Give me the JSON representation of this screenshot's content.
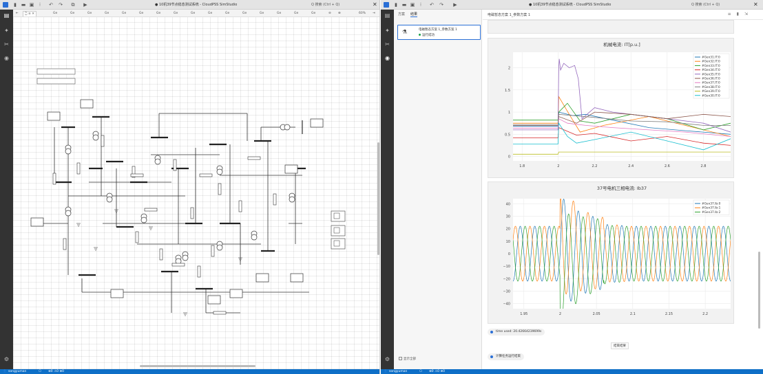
{
  "left": {
    "title": "● 10机39节点稳态测试系统 - CloudPSS SimStudio",
    "search": "Q 搜索 (Ctrl + Q)",
    "tabs": [
      "Ge",
      "Ge",
      "Ge",
      "Ge",
      "Ge",
      "Ge",
      "Ge",
      "Ge",
      "Ge",
      "Ge",
      "Ge",
      "Ge",
      "Ge",
      "Ge",
      "Ge",
      "Ge"
    ],
    "zoom": "60%",
    "status": {
      "user": "songyuman",
      "counts": "⊗0 ⚠0 ⊛0"
    }
  },
  "right": {
    "title": "● 10机39节点稳态测试系统 - CloudPSS SimStudio",
    "search": "Q 搜索 (Ctrl + Q)",
    "side_tabs": [
      "方案",
      "结果"
    ],
    "item_title": "电磁暂态方案 1_参数方案 1",
    "item_status": "运行成功",
    "show_all": "显示全部",
    "result_title": "电磁暂态方案 1_参数方案 1",
    "time_pill": "time used: 20.42664239699s",
    "btn_clear": "结束结果",
    "done_pill": "计算任务运行结束",
    "status": {
      "user": "songyuman",
      "counts": "⊗0 ⚠0 ⊛0"
    }
  },
  "colors": {
    "accent": "#2a6fd6",
    "status": "#0e6fc7",
    "ok": "#1aa34a"
  },
  "chart_data": [
    {
      "type": "line",
      "title": "机械电流: IT[p.u.]",
      "xlim": [
        1.75,
        2.95
      ],
      "ylim": [
        -0.1,
        2.35
      ],
      "xticks": [
        1.8,
        2,
        2.2,
        2.4,
        2.6,
        2.8
      ],
      "yticks": [
        0,
        0.5,
        1,
        1.5,
        2
      ],
      "ytick_labels": [
        "0",
        "0.5",
        "1",
        "1.5",
        "2"
      ],
      "xlabel": "",
      "ylabel": "",
      "legend": "top-right",
      "series": [
        {
          "name": "#Gen31.IT:0",
          "color": "#1f77b4",
          "x": [
            1.75,
            1.998,
            2.002,
            2.08,
            2.15,
            2.3,
            2.5,
            2.7,
            2.95
          ],
          "y": [
            0.68,
            0.68,
            1.0,
            0.92,
            0.95,
            0.82,
            0.65,
            0.58,
            0.5
          ]
        },
        {
          "name": "#Gen32.IT:0",
          "color": "#ff7f0e",
          "x": [
            1.75,
            1.998,
            2.002,
            2.06,
            2.12,
            2.25,
            2.5,
            2.75,
            2.95
          ],
          "y": [
            0.75,
            0.75,
            1.35,
            0.95,
            0.55,
            0.7,
            0.9,
            0.65,
            0.45
          ]
        },
        {
          "name": "#Gen33.IT:0",
          "color": "#2ca02c",
          "x": [
            1.75,
            1.998,
            2.002,
            2.05,
            2.12,
            2.2,
            2.4,
            2.6,
            2.8,
            2.95
          ],
          "y": [
            0.82,
            0.82,
            1.0,
            1.2,
            0.8,
            0.75,
            0.95,
            0.85,
            0.6,
            0.75
          ]
        },
        {
          "name": "#Gen34.IT:0",
          "color": "#d62728",
          "x": [
            1.75,
            1.998,
            2.002,
            2.1,
            2.2,
            2.4,
            2.6,
            2.8,
            2.95
          ],
          "y": [
            0.42,
            0.42,
            0.65,
            0.48,
            0.52,
            0.35,
            0.45,
            0.3,
            0.25
          ]
        },
        {
          "name": "#Gen35.IT:0",
          "color": "#9467bd",
          "x": [
            1.75,
            1.998,
            2.002,
            2.005,
            2.012,
            2.03,
            2.06,
            2.09,
            2.11,
            2.13,
            2.2,
            2.3,
            2.4,
            2.6,
            2.8,
            2.95
          ],
          "y": [
            0.6,
            0.6,
            2.0,
            2.2,
            1.95,
            2.1,
            2.0,
            2.05,
            1.75,
            0.85,
            1.1,
            1.0,
            0.95,
            0.85,
            0.75,
            0.55
          ]
        },
        {
          "name": "#Gen36.IT:0",
          "color": "#8c564b",
          "x": [
            1.75,
            1.998,
            2.002,
            2.1,
            2.2,
            2.4,
            2.6,
            2.8,
            2.95
          ],
          "y": [
            0.7,
            0.7,
            0.9,
            0.75,
            1.0,
            0.95,
            0.85,
            0.95,
            0.9
          ]
        },
        {
          "name": "#Gen37.IT:0",
          "color": "#e377c2",
          "x": [
            1.75,
            1.998,
            2.002,
            2.05,
            2.15,
            2.3,
            2.5,
            2.7,
            2.95
          ],
          "y": [
            0.64,
            0.64,
            0.85,
            0.75,
            0.7,
            0.65,
            0.6,
            0.55,
            0.45
          ]
        },
        {
          "name": "#Gen38.IT:0",
          "color": "#7f7f7f",
          "x": [
            1.75,
            1.998,
            2.002,
            2.2,
            2.4,
            2.6,
            2.8,
            2.95
          ],
          "y": [
            0.72,
            0.72,
            0.95,
            0.88,
            0.8,
            0.78,
            0.7,
            0.7
          ]
        },
        {
          "name": "#Gen39.IT:0",
          "color": "#bcbd22",
          "x": [
            1.75,
            1.998,
            2.002,
            2.2,
            2.4,
            2.6,
            2.8,
            2.95
          ],
          "y": [
            0.05,
            0.05,
            0.1,
            0.1,
            0.1,
            0.1,
            0.1,
            0.1
          ]
        },
        {
          "name": "#Gen30.IT:0",
          "color": "#17becf",
          "x": [
            1.75,
            1.998,
            2.002,
            2.05,
            2.1,
            2.2,
            2.4,
            2.6,
            2.8,
            2.95
          ],
          "y": [
            0.28,
            0.28,
            0.75,
            0.45,
            0.3,
            0.38,
            0.55,
            0.35,
            0.15,
            0.4
          ]
        }
      ]
    },
    {
      "type": "line",
      "title": "37号电机三相电流: Ib37",
      "xlim": [
        1.935,
        2.235
      ],
      "ylim": [
        -44,
        44
      ],
      "xticks": [
        1.95,
        2,
        2.05,
        2.1,
        2.15,
        2.2
      ],
      "yticks": [
        -40,
        -30,
        -20,
        -10,
        0,
        10,
        20,
        30,
        40
      ],
      "ytick_labels": [
        "−40",
        "−30",
        "−20",
        "−10",
        "0",
        "10",
        "20",
        "30",
        "40"
      ],
      "xlabel": "",
      "ylabel": "",
      "legend": "top-right",
      "wave": {
        "freq": 50,
        "amp_base": 22,
        "fault_start": 2.0,
        "fault_end": 2.06
      },
      "series": [
        {
          "name": "#Gen37.Ib:0",
          "color": "#1f77b4",
          "phase": 0
        },
        {
          "name": "#Gen37.Ib:1",
          "color": "#ff7f0e",
          "phase": 2.094
        },
        {
          "name": "#Gen37.Ib:2",
          "color": "#2ca02c",
          "phase": 4.189
        }
      ]
    }
  ]
}
